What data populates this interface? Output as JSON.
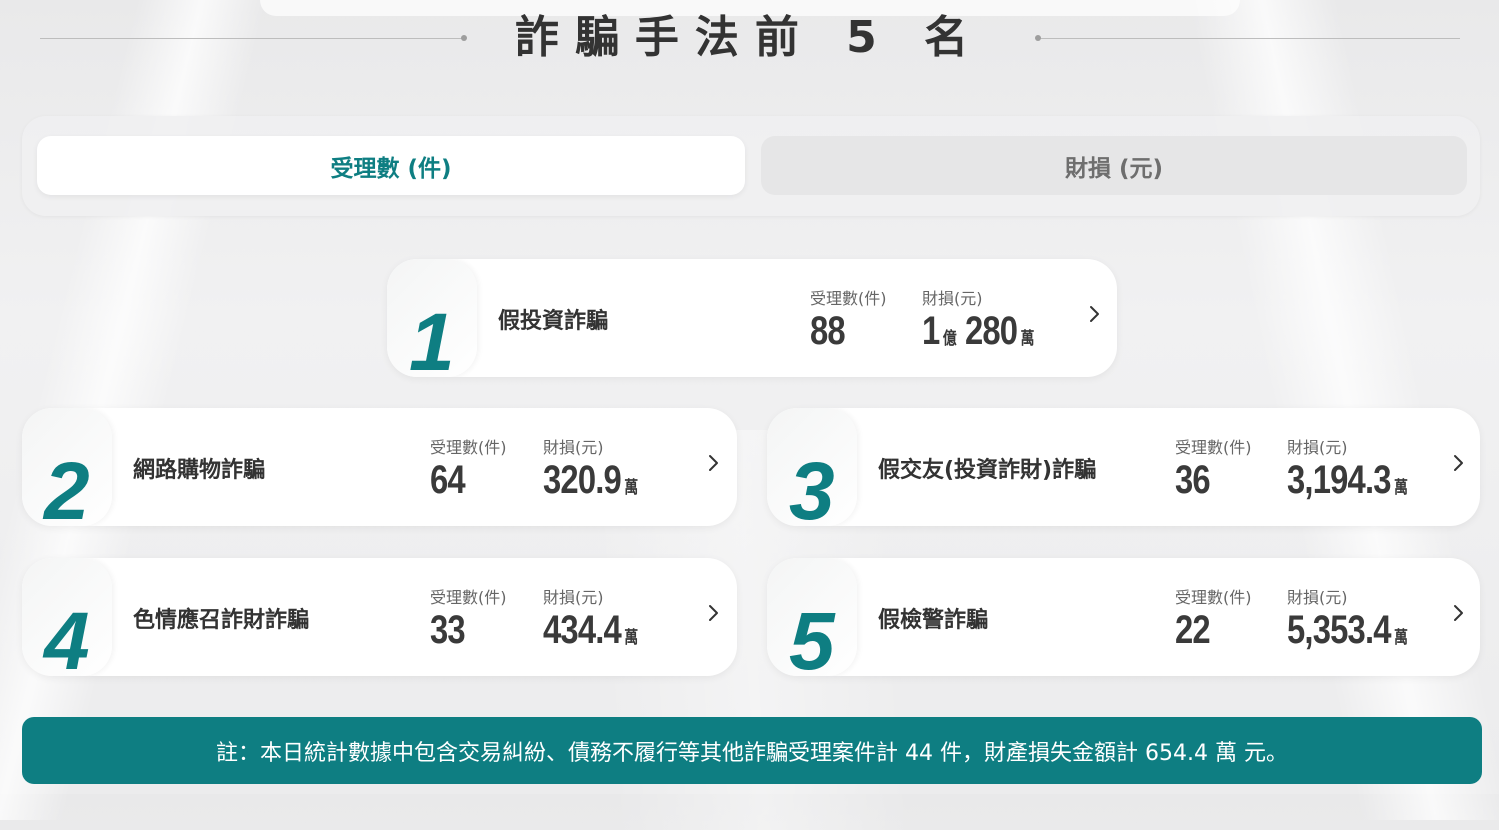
{
  "header": {
    "title": "詐騙手法前 5 名"
  },
  "tabs": [
    {
      "label": "受理數 (件)",
      "active": true
    },
    {
      "label": "財損 (元)",
      "active": false
    }
  ],
  "colors": {
    "accent": "#0e7e82",
    "text": "#333333"
  },
  "ranking": [
    {
      "rank": "1",
      "name": "假投資詐騙",
      "cases_label": "受理數(件)",
      "cases": "88",
      "loss_label": "財損(元)",
      "loss": "1",
      "loss_unit": "億",
      "loss2": "280",
      "loss2_unit": "萬"
    },
    {
      "rank": "2",
      "name": "網路購物詐騙",
      "cases_label": "受理數(件)",
      "cases": "64",
      "loss_label": "財損(元)",
      "loss": "320.9",
      "loss_unit": "萬"
    },
    {
      "rank": "3",
      "name": "假交友(投資詐財)詐騙",
      "cases_label": "受理數(件)",
      "cases": "36",
      "loss_label": "財損(元)",
      "loss": "3,194.3",
      "loss_unit": "萬"
    },
    {
      "rank": "4",
      "name": "色情應召詐財詐騙",
      "cases_label": "受理數(件)",
      "cases": "33",
      "loss_label": "財損(元)",
      "loss": "434.4",
      "loss_unit": "萬"
    },
    {
      "rank": "5",
      "name": "假檢警詐騙",
      "cases_label": "受理數(件)",
      "cases": "22",
      "loss_label": "財損(元)",
      "loss": "5,353.4",
      "loss_unit": "萬"
    }
  ],
  "icons": {
    "chevron": "chevron-right-icon"
  },
  "footer": {
    "note": "註：本日統計數據中包含交易糾紛、債務不履行等其他詐騙受理案件計 44 件，財產損失金額計 654.4 萬 元。"
  }
}
